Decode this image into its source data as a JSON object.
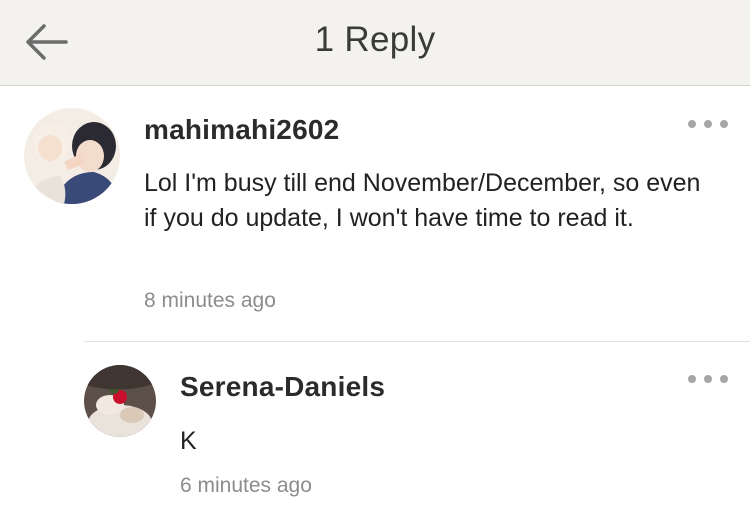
{
  "header": {
    "title": "1 Reply"
  },
  "comment": {
    "username": "mahimahi2602",
    "text": "Lol I'm busy till end November/December, so even if you do update, I won't have time to read it.",
    "timestamp": "8 minutes ago"
  },
  "reply": {
    "username": "Serena-Daniels",
    "text": "K",
    "timestamp": "6 minutes ago"
  },
  "icons": {
    "back": "arrow-left-icon",
    "more": "more-dots-icon"
  },
  "colors": {
    "header_bg": "#f3f2ee",
    "text": "#222222",
    "meta": "#8c8c8c",
    "dots": "#a6a6a6"
  }
}
